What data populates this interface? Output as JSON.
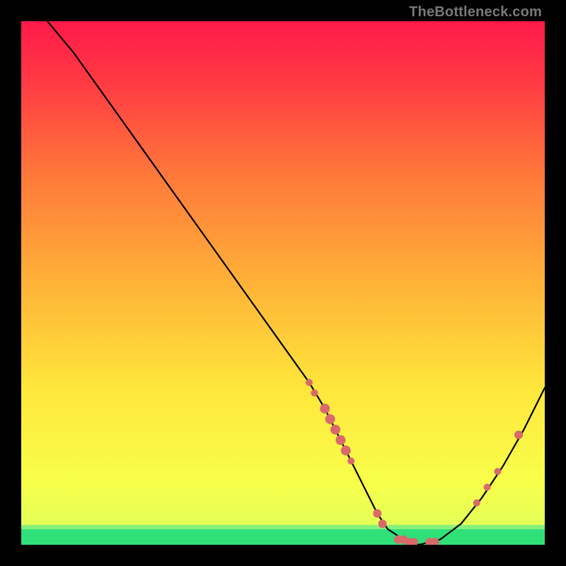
{
  "attribution": "TheBottleneck.com",
  "chart_data": {
    "type": "line",
    "title": "",
    "xlabel": "",
    "ylabel": "",
    "xlim": [
      0,
      100
    ],
    "ylim": [
      0,
      100
    ],
    "grid": false,
    "legend": false,
    "background_gradient": {
      "top_color": "#ff1a4a",
      "mid_color": "#ffe63b",
      "bottom_band_color": "#2fe178",
      "bottom_band_height_pct": 3
    },
    "series": [
      {
        "name": "bottleneck-curve",
        "color": "#000000",
        "x": [
          5,
          10,
          15,
          20,
          25,
          30,
          35,
          40,
          45,
          50,
          55,
          58,
          60,
          62,
          65,
          68,
          70,
          73,
          76,
          80,
          84,
          88,
          92,
          96,
          100
        ],
        "y": [
          100,
          94,
          87,
          80,
          73,
          66,
          59,
          52,
          45,
          38,
          31,
          26,
          22,
          18,
          12,
          6,
          3,
          1,
          0,
          1,
          4,
          9,
          15,
          22,
          30
        ]
      }
    ],
    "markers": {
      "name": "bottleneck-data-points",
      "color": "#d86a6a",
      "points": [
        {
          "x": 55,
          "y": 31,
          "r": 5
        },
        {
          "x": 56,
          "y": 29,
          "r": 5
        },
        {
          "x": 58,
          "y": 26,
          "r": 7
        },
        {
          "x": 59,
          "y": 24,
          "r": 7
        },
        {
          "x": 60,
          "y": 22,
          "r": 7
        },
        {
          "x": 61,
          "y": 20,
          "r": 7
        },
        {
          "x": 62,
          "y": 18,
          "r": 7
        },
        {
          "x": 63,
          "y": 16,
          "r": 5
        },
        {
          "x": 68,
          "y": 6,
          "r": 6
        },
        {
          "x": 69,
          "y": 4,
          "r": 6
        },
        {
          "x": 72,
          "y": 1,
          "r": 6
        },
        {
          "x": 73,
          "y": 1,
          "r": 6
        },
        {
          "x": 74,
          "y": 0.5,
          "r": 6
        },
        {
          "x": 75,
          "y": 0.5,
          "r": 6
        },
        {
          "x": 78,
          "y": 0.5,
          "r": 6
        },
        {
          "x": 79,
          "y": 0.5,
          "r": 6
        },
        {
          "x": 87,
          "y": 8,
          "r": 5
        },
        {
          "x": 89,
          "y": 11,
          "r": 5
        },
        {
          "x": 91,
          "y": 14,
          "r": 5
        },
        {
          "x": 95,
          "y": 21,
          "r": 6
        }
      ]
    }
  }
}
